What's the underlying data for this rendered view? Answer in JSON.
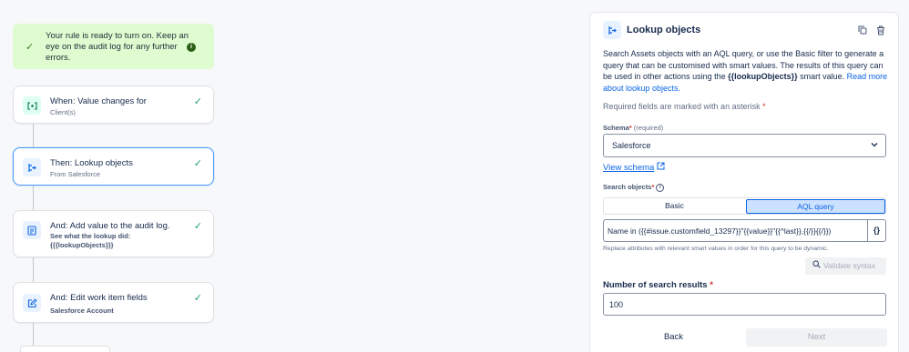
{
  "banner": {
    "text": "Your rule is ready to turn on. Keep an eye on the audit log for any further errors."
  },
  "steps": [
    {
      "title": "When: Value changes for",
      "subtitle": "Client(s)",
      "icon": "trigger-icon"
    },
    {
      "title": "Then: Lookup objects",
      "subtitle": "From Salesforce",
      "icon": "lookup-icon"
    },
    {
      "title": "And: Add value to the audit log.",
      "subtitle": "See what the lookup did: {{{lookupObjects}}}",
      "icon": "audit-log-icon"
    },
    {
      "title": "And: Edit work item fields",
      "subtitle": "Salesforce Account",
      "icon": "edit-icon"
    }
  ],
  "panel": {
    "title": "Lookup objects",
    "description_1": "Search Assets objects with an AQL query, or use the Basic filter to generate a query that can be customised with smart values. The results of this query can be used in other actions using the ",
    "description_smart": "{{lookupObjects}}",
    "description_2": " smart value. ",
    "description_link": "Read more about lookup objects.",
    "required_note": "Required fields are marked with an asterisk",
    "schema_label": "Schema",
    "schema_required": "(required)",
    "schema_value": "Salesforce",
    "view_schema": "View schema",
    "search_label": "Search objects",
    "mode_basic": "Basic",
    "mode_aql": "AQL query",
    "query_value": "Name in ({{#issue.customfield_13297}}\"{{value}}\"{{^last}},{{/}}{{/}})",
    "braces": "{}",
    "hint": "Replace attributes with relevant smart values in order for this query to be dynamic.",
    "validate_label": "Validate syntax",
    "results_label": "Number of search results",
    "results_value": "100",
    "back_label": "Back",
    "next_label": "Next"
  },
  "colors": {
    "banner_bg": "#dffcd0",
    "accent": "#0c66e4",
    "success": "#22a06b",
    "required": "#c9372c"
  }
}
